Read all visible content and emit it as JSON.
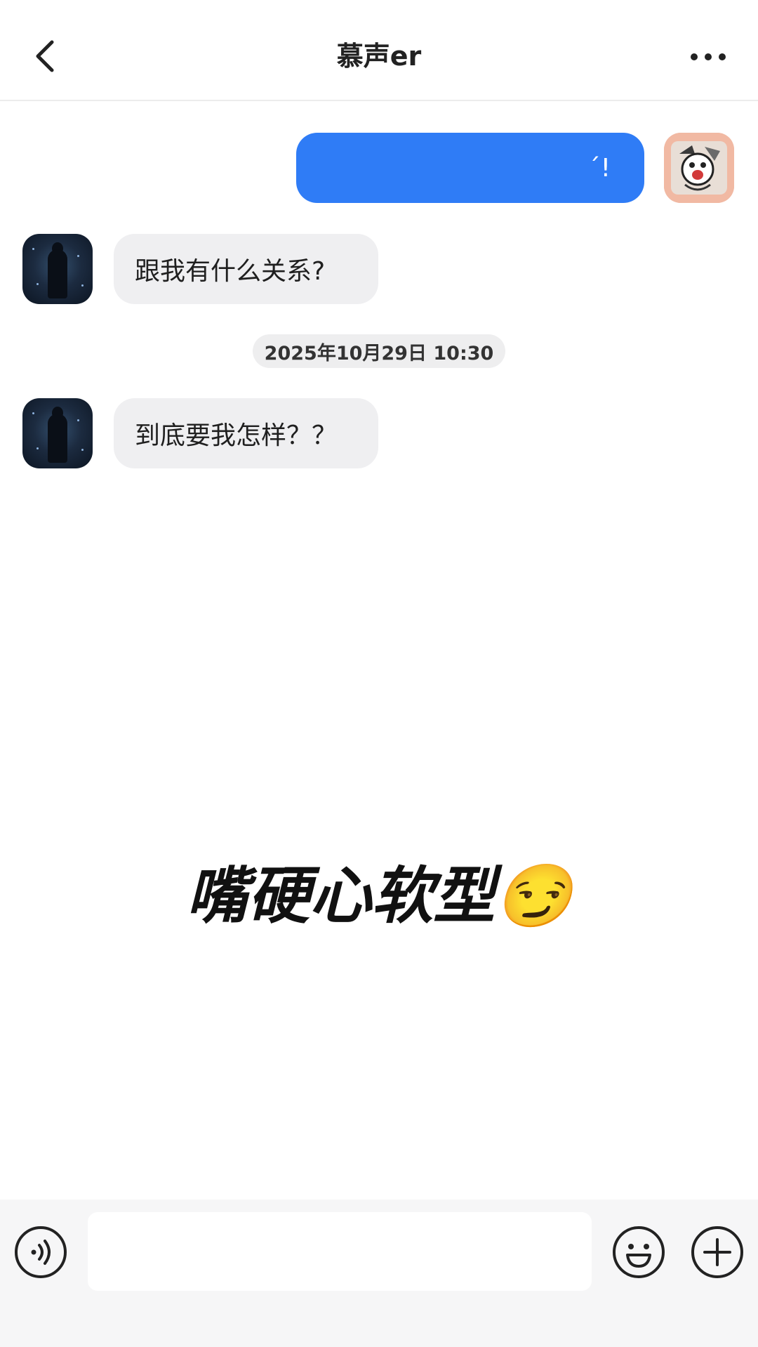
{
  "header": {
    "title": "慕声er"
  },
  "messages": {
    "outgoing_1": {
      "text": "ˊ!"
    },
    "incoming_1": {
      "text": "跟我有什么关系?"
    },
    "timestamp": "2025年10月29日 10:30",
    "incoming_2": {
      "text": "到底要我怎样？？"
    }
  },
  "caption": {
    "text": "嘴硬心软型😏"
  },
  "input": {
    "value": "",
    "placeholder": ""
  },
  "icons": {
    "back": "chevron-left-icon",
    "more": "more-dots-icon",
    "voice": "voice-icon",
    "emoji": "emoji-icon",
    "plus": "plus-icon"
  },
  "colors": {
    "outgoing_bubble": "#2f7cf6",
    "incoming_bubble": "#efeff1",
    "input_bar": "#f6f6f7"
  }
}
